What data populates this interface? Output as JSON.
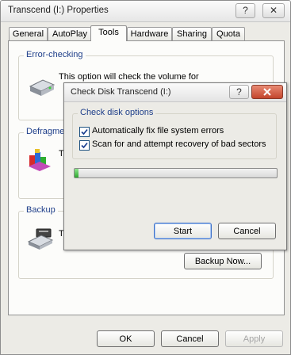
{
  "window": {
    "title": "Transcend (I:) Properties",
    "help_btn": "?",
    "close_btn": "✕"
  },
  "tabs": [
    "General",
    "AutoPlay",
    "Tools",
    "Hardware",
    "Sharing",
    "Quota"
  ],
  "active_tab": 2,
  "tools": {
    "error_checking": {
      "label": "Error-checking",
      "text": "This option will check the volume for"
    },
    "defrag": {
      "label": "Defragme",
      "text": "T"
    },
    "backup": {
      "label": "Backup",
      "text": "T",
      "button": "Backup Now..."
    }
  },
  "dialog": {
    "title": "Check Disk Transcend (I:)",
    "help_btn": "?",
    "group_label": "Check disk options",
    "option1": "Automatically fix file system errors",
    "option1_checked": true,
    "option2": "Scan for and attempt recovery of bad sectors",
    "option2_checked": true,
    "progress": 0.02,
    "start_label": "Start",
    "cancel_label": "Cancel"
  },
  "footer": {
    "ok_label": "OK",
    "cancel_label": "Cancel",
    "apply_label": "Apply"
  },
  "colors": {
    "group_label": "#1f3f8a",
    "progress_green": "#2fa82f"
  }
}
